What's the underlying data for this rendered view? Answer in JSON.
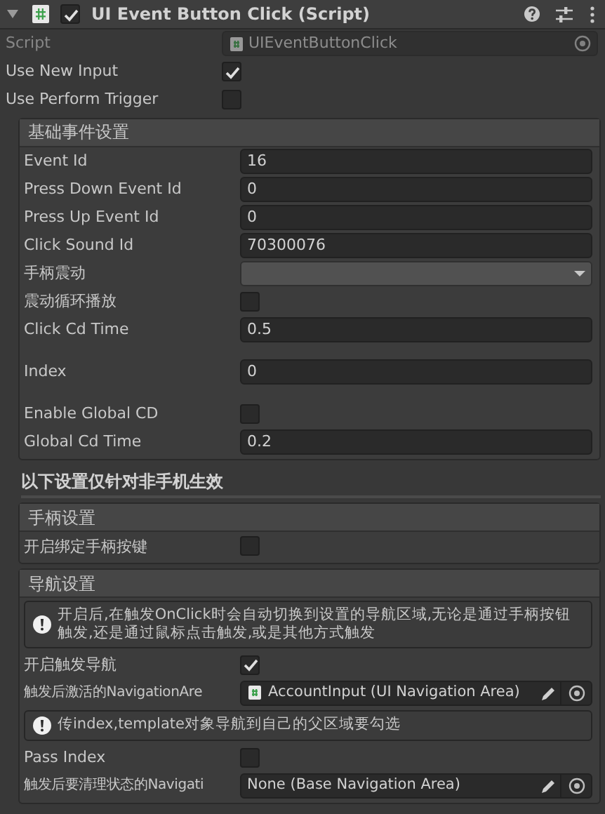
{
  "component": {
    "title": "UI Event Button Click (Script)",
    "enabled": true,
    "expanded": true
  },
  "rows": [
    {
      "kind": "object",
      "label": "Script",
      "value": "UIEventButtonClick",
      "disabled": true
    },
    {
      "kind": "checkbox",
      "label": "Use New Input",
      "checked": true
    },
    {
      "kind": "checkbox",
      "label": "Use Perform Trigger",
      "checked": false
    }
  ],
  "sections": [
    {
      "kind": "group",
      "title": "基础事件设置",
      "rows": [
        {
          "kind": "text",
          "label": "Event Id",
          "value": "16"
        },
        {
          "kind": "text",
          "label": "Press Down Event Id",
          "value": "0"
        },
        {
          "kind": "text",
          "label": "Press Up Event Id",
          "value": "0"
        },
        {
          "kind": "text",
          "label": "Click Sound Id",
          "value": "70300076"
        },
        {
          "kind": "dropdown",
          "label": "手柄震动"
        },
        {
          "kind": "checkbox",
          "label": "震动循环播放",
          "checked": false
        },
        {
          "kind": "text",
          "label": "Click Cd Time",
          "value": "0.5"
        },
        {
          "kind": "text",
          "label": "Index",
          "value": "0",
          "space_before": true
        },
        {
          "kind": "checkbox",
          "label": "Enable Global CD",
          "checked": false,
          "space_before": true
        },
        {
          "kind": "text",
          "label": "Global Cd Time",
          "value": "0.2"
        }
      ]
    },
    {
      "kind": "heading",
      "title": "以下设置仅针对非手机生效"
    },
    {
      "kind": "group",
      "title": "手柄设置",
      "rows": [
        {
          "kind": "checkbox",
          "label": "开启绑定手柄按键",
          "checked": false
        }
      ]
    },
    {
      "kind": "group",
      "title": "导航设置",
      "rows": [
        {
          "kind": "help",
          "text": "开启后,在触发OnClick时会自动切换到设置的导航区域,无论是通过手柄按钮触发,还是通过鼠标点击触发,或是其他方式触发"
        },
        {
          "kind": "checkbox",
          "label": "开启触发导航",
          "checked": true
        },
        {
          "kind": "reference",
          "label": "触发后激活的NavigationAre",
          "value": "AccountInput (UI Navigation Area)",
          "has_icon": true
        },
        {
          "kind": "help",
          "text": "传index,template对象导航到自己的父区域要勾选"
        },
        {
          "kind": "checkbox",
          "label": "Pass Index",
          "checked": false
        },
        {
          "kind": "reference",
          "label": "触发后要清理状态的Navigati",
          "value": "None (Base Navigation Area)",
          "has_icon": false
        }
      ]
    }
  ]
}
